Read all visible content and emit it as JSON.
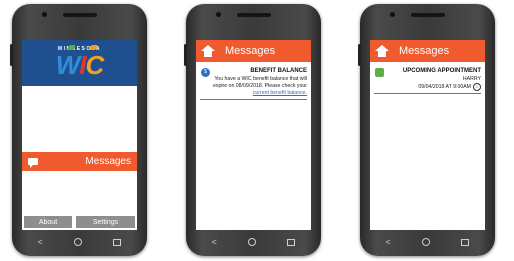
{
  "phone1": {
    "logo_state": "MINNESOTA",
    "logo_w": "W",
    "logo_i": "I",
    "logo_c": "C",
    "messages_label": "Messages",
    "about_label": "About",
    "settings_label": "Settings"
  },
  "phone2": {
    "header_title": "Messages",
    "card_title": "BENEFIT BALANCE",
    "body_line1": "You have a WIC benefit balance that will",
    "body_line2": "expire on 08/09/2018. Please check your",
    "link_text": "current benefit balance."
  },
  "phone3": {
    "header_title": "Messages",
    "card_title": "UPCOMING APPOINTMENT",
    "name": "HARRY",
    "datetime": "09/04/2018 AT 9:00AM"
  },
  "nav": {
    "back": "<"
  },
  "colors": {
    "accent": "#ef5a2e",
    "logo_bg": "#1f4f8f",
    "link": "#2a6fd6"
  },
  "icons": [
    "home-icon",
    "message-icon",
    "dollar-icon",
    "calendar-icon",
    "download-icon",
    "back-icon",
    "nav-home-icon",
    "recent-apps-icon"
  ]
}
